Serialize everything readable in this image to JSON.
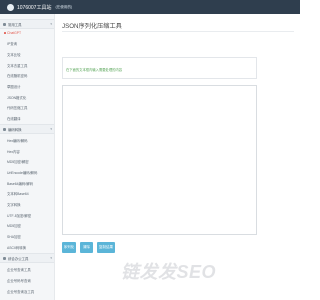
{
  "header": {
    "site_name": "1076007工具站",
    "badge": "(在使用的)"
  },
  "sidebar": {
    "groups": [
      {
        "label": "常用工具",
        "items": [
          "ChatGPT",
          "IP查询",
          "文本比较",
          "文本去重工具",
          "在线随机密码",
          "草图设计",
          "JSON格式化",
          "代码压缩工具",
          "在线翻译"
        ]
      },
      {
        "label": "编码转换",
        "items": [
          "Hex编码/解码",
          "Hex内容",
          "MD5加密/解密",
          "UrlEncode编码/解码",
          "Base64编码/解码",
          "文本转Base64",
          "文字转换",
          "UTF-8加密/解密",
          "MD5加密",
          "SHA加密",
          "ASCII码转换"
        ]
      },
      {
        "label": "综合办公工具",
        "items": [
          "企业号查询工具",
          "企业号码号查询",
          "企业号查询及工具"
        ]
      }
    ],
    "active_item": "ChatGPT"
  },
  "main": {
    "title": "JSON序列化压缩工具",
    "hint": "在下面的文本框内输入需要处理的内容",
    "input_value": "",
    "buttons": {
      "serialize": "序列化",
      "clear": "清除",
      "copy": "复制结果"
    }
  },
  "watermark": "链发发SEO"
}
